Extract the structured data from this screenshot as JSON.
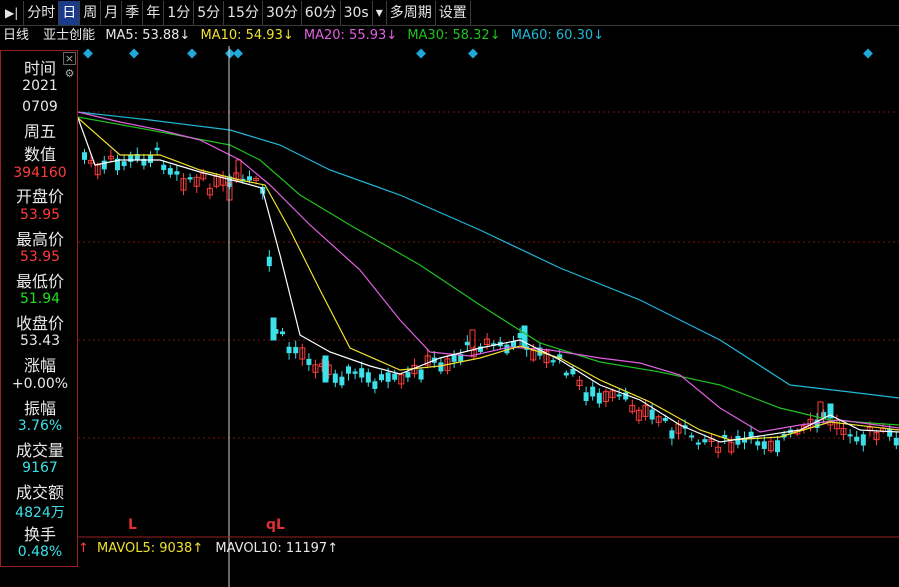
{
  "toolbar": {
    "items": [
      "分时",
      "日",
      "周",
      "月",
      "季",
      "年",
      "1分",
      "5分",
      "15分",
      "30分",
      "60分",
      "30s",
      "▾",
      "多周期",
      "设置"
    ],
    "active_index": 1
  },
  "info": {
    "period": "日线",
    "stock_name": "亚士创能",
    "ma5_label": "MA5: 53.88↓",
    "ma10_label": "MA10: 54.93↓",
    "ma20_label": "MA20: 55.93↓",
    "ma30_label": "MA30: 58.32↓",
    "ma60_label": "MA60: 60.30↓"
  },
  "panel": {
    "time_label": "时间",
    "year": "2021",
    "date": "0709",
    "weekday": "周五",
    "value_label": "数值",
    "value": "394160",
    "open_label": "开盘价",
    "open": "53.95",
    "high_label": "最高价",
    "high": "53.95",
    "low_label": "最低价",
    "low": "51.94",
    "close_label": "收盘价",
    "close": "53.43",
    "change_label": "涨幅",
    "change": "+0.00%",
    "amplitude_label": "振幅",
    "amplitude": "3.76%",
    "volume_label": "成交量",
    "volume": "9167",
    "turnover_label": "成交额",
    "turnover": "4824万",
    "exchange_label": "换手",
    "exchange": "0.48%"
  },
  "volume_indicator": {
    "mavol5": "MAVOL5: 9038↑",
    "mavol10": "MAVOL10: 11197↑"
  },
  "markers": {
    "left_marker": "L",
    "right_marker": "qL"
  },
  "colors": {
    "up": "#ff3c3c",
    "down": "#3ce0e8",
    "ma5": "#ffffff",
    "ma10": "#f0e030",
    "ma20": "#e060e0",
    "ma30": "#20c020",
    "ma60": "#20b8d8",
    "panel_border": "#9a2020",
    "cursor": "#d0d0d0",
    "diamond": "#20a8d8"
  },
  "chart_data": {
    "type": "candlestick",
    "ma_series": [
      "MA5",
      "MA10",
      "MA20",
      "MA30",
      "MA60"
    ],
    "selected_candle": {
      "date": "2021-07-09",
      "open": 53.95,
      "high": 53.95,
      "low": 51.94,
      "close": 53.43
    }
  }
}
